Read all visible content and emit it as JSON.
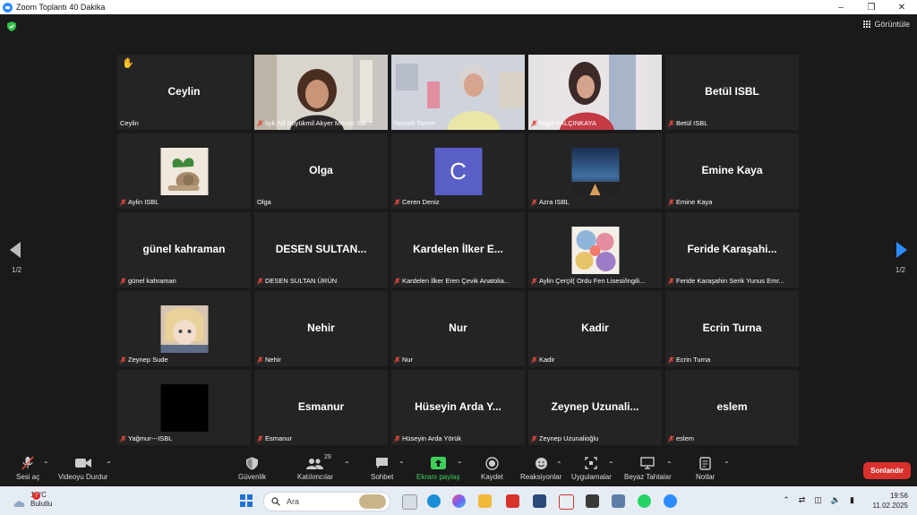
{
  "window": {
    "title": "Zoom Toplantı 40 Dakika",
    "controls": [
      "minimize",
      "restore",
      "close"
    ]
  },
  "stage": {
    "view_label": "Görüntüle",
    "page_left": "1/2",
    "page_right": "1/2"
  },
  "tiles": [
    {
      "big": "Ceylin",
      "name": "Ceylin",
      "muted": false,
      "hand": "✋"
    },
    {
      "big": "",
      "name": "Işık Nil Büyükmil Akyer Mersin Sili...",
      "muted": true,
      "video": "woman-curly-hair"
    },
    {
      "big": "",
      "name": "Nurseli Tamer",
      "muted": false,
      "video": "woman-gray-hair",
      "active": true
    },
    {
      "big": "",
      "name": "Bilge YALÇINKAYA",
      "muted": true,
      "video": "woman-dark-hair"
    },
    {
      "big": "Betül ISBL",
      "name": "Betül ISBL",
      "muted": true
    },
    {
      "big": "",
      "name": "Aylin ISBL",
      "muted": true,
      "avatar": "snail-plant"
    },
    {
      "big": "Olga",
      "name": "Olga",
      "muted": false
    },
    {
      "big": "",
      "name": "Ceren Deniz",
      "muted": true,
      "avatar_letter": "C"
    },
    {
      "big": "",
      "name": "Azra ISBL",
      "muted": true,
      "avatar": "night-sky"
    },
    {
      "big": "Emine Kaya",
      "name": "Emine Kaya",
      "muted": true
    },
    {
      "big": "günel kahraman",
      "name": "günel kahraman",
      "muted": true
    },
    {
      "big": "DESEN  SULTAN...",
      "name": "DESEN  SULTAN ÜRÜN",
      "muted": true
    },
    {
      "big": "Kardelen  İlker  E...",
      "name": "Kardelen İlker Eren Çevik Anatolia...",
      "muted": true
    },
    {
      "big": "",
      "name": "Aylin Çerçil( Ordu Fen Lisesi/ingili...",
      "muted": true,
      "avatar": "collage"
    },
    {
      "big": "Feride  Karaşahi...",
      "name": "Feride Karaşahin Serik Yunus Emr...",
      "muted": true
    },
    {
      "big": "",
      "name": "Zeynep Sude",
      "muted": true,
      "avatar": "anime"
    },
    {
      "big": "Nehir",
      "name": "Nehir",
      "muted": true
    },
    {
      "big": "Nur",
      "name": "Nur",
      "muted": true
    },
    {
      "big": "Kadir",
      "name": "Kadir",
      "muted": true
    },
    {
      "big": "Ecrin Turna",
      "name": "Ecrin Turna",
      "muted": true
    },
    {
      "big": "",
      "name": "Yağmur---ISBL",
      "muted": true,
      "avatar": "black"
    },
    {
      "big": "Esmanur",
      "name": "Esmanur",
      "muted": true
    },
    {
      "big": "Hüseyin  Arda  Y...",
      "name": "Hüseyin Arda Yörük",
      "muted": true
    },
    {
      "big": "Zeynep  Uzunali...",
      "name": "Zeynep Uzunalioğlu",
      "muted": true
    },
    {
      "big": "eslem",
      "name": "eslem",
      "muted": true
    }
  ],
  "toolbar": {
    "audio": "Sesi aç",
    "video": "Videoyu Durdur",
    "security": "Güvenlik",
    "participants": "Katılımcılar",
    "participants_count": "29",
    "chat": "Sohbet",
    "share": "Ekranı paylaş",
    "record": "Kaydet",
    "reactions": "Reaksiyonlar",
    "apps": "Uygulamalar",
    "whiteboards": "Beyaz Tahtalar",
    "notes": "Notlar",
    "end": "Sonlandır"
  },
  "taskbar": {
    "weather_temp": "12°C",
    "weather_desc": "Bulutlu",
    "weather_badge": "7",
    "search_placeholder": "Ara",
    "time": "19:56",
    "date": "11.02.2025"
  },
  "colors": {
    "accent_blue": "#2d8cff",
    "active_speaker": "#e8ea6b",
    "end_red": "#d9302c",
    "share_green": "#3fd05c",
    "tile_bg": "#242424",
    "stage_bg": "#1a1a1a"
  }
}
